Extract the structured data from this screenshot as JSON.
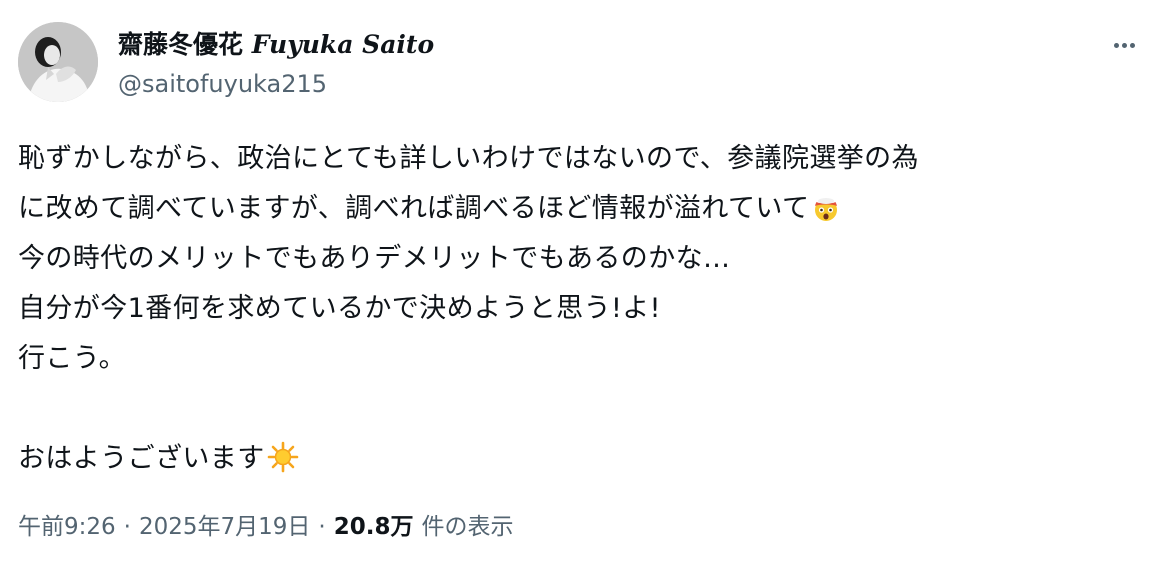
{
  "author": {
    "display_name_jp": "齋藤冬優花",
    "display_name_en": "Fuyuka Saito",
    "handle": "@saitofuyuka215",
    "avatar_icon": "profile-photo"
  },
  "more_icon": "more-horizontal-icon",
  "tweet": {
    "lines": [
      "恥ずかしながら、政治にとても詳しいわけではないので、参議院選挙の為",
      "に改めて調べていますが、調べれば調べるほど情報が溢れていて",
      "今の時代のメリットでもありデメリットでもあるのかな…",
      "自分が今1番何を求めているかで決めようと思う!よ!",
      "行こう。",
      "",
      "おはようございます"
    ],
    "emojis": {
      "line2": "exploding-head-emoji",
      "line7": "sun-emoji"
    }
  },
  "meta": {
    "time": "午前9:26",
    "separator": "·",
    "date": "2025年7月19日",
    "views_count": "20.8万",
    "views_label": "件の表示"
  }
}
